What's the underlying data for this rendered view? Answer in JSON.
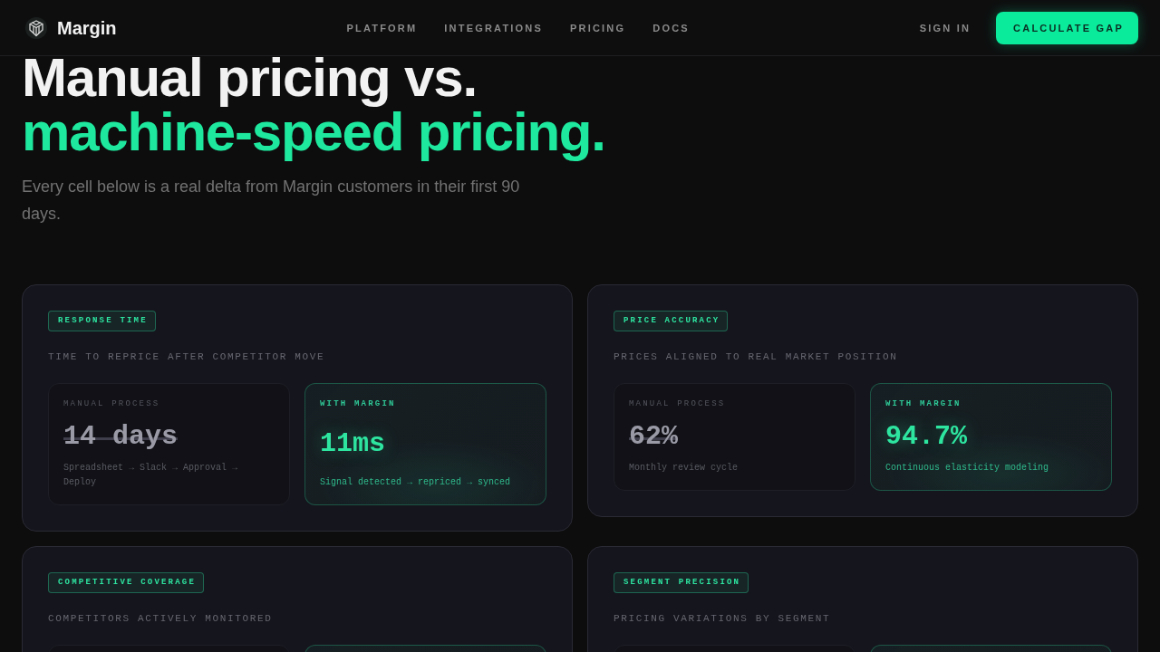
{
  "header": {
    "brand": "Margin",
    "nav": [
      "PLATFORM",
      "INTEGRATIONS",
      "PRICING",
      "DOCS"
    ],
    "sign_in": "SIGN IN",
    "cta": "CALCULATE GAP"
  },
  "hero": {
    "title": [
      {
        "text": "Manual pricing vs.",
        "accent": false
      },
      {
        "text": "machine-speed pricing.",
        "accent": true
      }
    ],
    "subtitle": "Every cell below is a real delta from Margin customers in their first 90 days."
  },
  "cards": [
    {
      "badge": "RESPONSE TIME",
      "caption": "TIME TO REPRICE AFTER COMPETITOR MOVE",
      "panels": [
        {
          "kind": "manual",
          "label": "MANUAL PROCESS",
          "value": "14 days",
          "description": "Spreadsheet → Slack → Approval → Deploy"
        },
        {
          "kind": "margin",
          "label": "WITH MARGIN",
          "value": "11ms",
          "description": "Signal detected → repriced → synced"
        }
      ]
    },
    {
      "badge": "PRICE ACCURACY",
      "caption": "PRICES ALIGNED TO REAL MARKET POSITION",
      "panels": [
        {
          "kind": "manual",
          "label": "MANUAL PROCESS",
          "value": "62%",
          "description": "Monthly review cycle"
        },
        {
          "kind": "margin",
          "label": "WITH MARGIN",
          "value": "94.7%",
          "description": "Continuous elasticity modeling"
        }
      ]
    },
    {
      "badge": "COMPETITIVE COVERAGE",
      "caption": "COMPETITORS ACTIVELY MONITORED",
      "panels": [
        {
          "kind": "manual"
        },
        {
          "kind": "margin"
        }
      ]
    },
    {
      "badge": "SEGMENT PRECISION",
      "caption": "PRICING VARIATIONS BY SEGMENT",
      "panels": [
        {
          "kind": "manual"
        },
        {
          "kind": "margin"
        }
      ]
    }
  ]
}
